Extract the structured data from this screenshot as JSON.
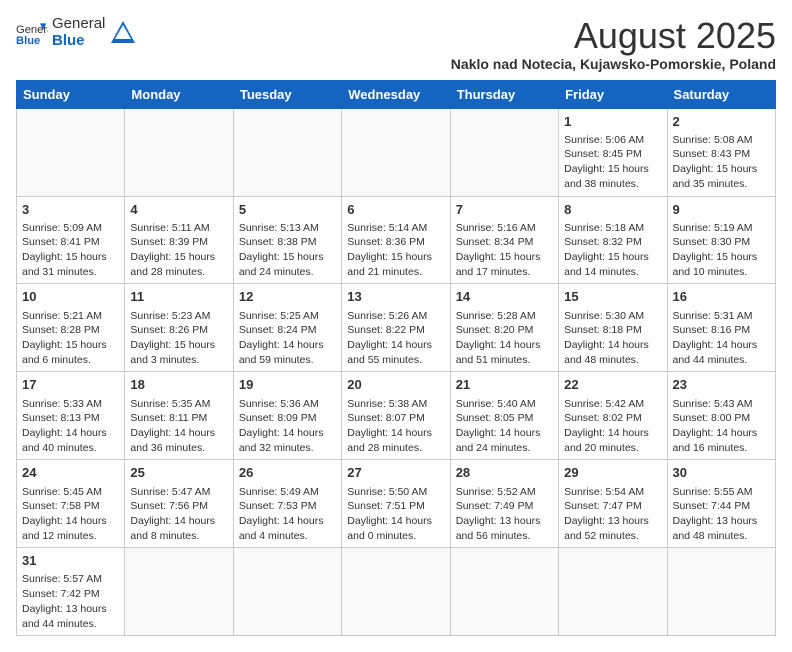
{
  "header": {
    "logo_general": "General",
    "logo_blue": "Blue",
    "month_title": "August 2025",
    "location": "Naklo nad Notecia, Kujawsko-Pomorskie, Poland"
  },
  "days_of_week": [
    "Sunday",
    "Monday",
    "Tuesday",
    "Wednesday",
    "Thursday",
    "Friday",
    "Saturday"
  ],
  "weeks": [
    [
      {
        "day": "",
        "info": ""
      },
      {
        "day": "",
        "info": ""
      },
      {
        "day": "",
        "info": ""
      },
      {
        "day": "",
        "info": ""
      },
      {
        "day": "",
        "info": ""
      },
      {
        "day": "1",
        "info": "Sunrise: 5:06 AM\nSunset: 8:45 PM\nDaylight: 15 hours and 38 minutes."
      },
      {
        "day": "2",
        "info": "Sunrise: 5:08 AM\nSunset: 8:43 PM\nDaylight: 15 hours and 35 minutes."
      }
    ],
    [
      {
        "day": "3",
        "info": "Sunrise: 5:09 AM\nSunset: 8:41 PM\nDaylight: 15 hours and 31 minutes."
      },
      {
        "day": "4",
        "info": "Sunrise: 5:11 AM\nSunset: 8:39 PM\nDaylight: 15 hours and 28 minutes."
      },
      {
        "day": "5",
        "info": "Sunrise: 5:13 AM\nSunset: 8:38 PM\nDaylight: 15 hours and 24 minutes."
      },
      {
        "day": "6",
        "info": "Sunrise: 5:14 AM\nSunset: 8:36 PM\nDaylight: 15 hours and 21 minutes."
      },
      {
        "day": "7",
        "info": "Sunrise: 5:16 AM\nSunset: 8:34 PM\nDaylight: 15 hours and 17 minutes."
      },
      {
        "day": "8",
        "info": "Sunrise: 5:18 AM\nSunset: 8:32 PM\nDaylight: 15 hours and 14 minutes."
      },
      {
        "day": "9",
        "info": "Sunrise: 5:19 AM\nSunset: 8:30 PM\nDaylight: 15 hours and 10 minutes."
      }
    ],
    [
      {
        "day": "10",
        "info": "Sunrise: 5:21 AM\nSunset: 8:28 PM\nDaylight: 15 hours and 6 minutes."
      },
      {
        "day": "11",
        "info": "Sunrise: 5:23 AM\nSunset: 8:26 PM\nDaylight: 15 hours and 3 minutes."
      },
      {
        "day": "12",
        "info": "Sunrise: 5:25 AM\nSunset: 8:24 PM\nDaylight: 14 hours and 59 minutes."
      },
      {
        "day": "13",
        "info": "Sunrise: 5:26 AM\nSunset: 8:22 PM\nDaylight: 14 hours and 55 minutes."
      },
      {
        "day": "14",
        "info": "Sunrise: 5:28 AM\nSunset: 8:20 PM\nDaylight: 14 hours and 51 minutes."
      },
      {
        "day": "15",
        "info": "Sunrise: 5:30 AM\nSunset: 8:18 PM\nDaylight: 14 hours and 48 minutes."
      },
      {
        "day": "16",
        "info": "Sunrise: 5:31 AM\nSunset: 8:16 PM\nDaylight: 14 hours and 44 minutes."
      }
    ],
    [
      {
        "day": "17",
        "info": "Sunrise: 5:33 AM\nSunset: 8:13 PM\nDaylight: 14 hours and 40 minutes."
      },
      {
        "day": "18",
        "info": "Sunrise: 5:35 AM\nSunset: 8:11 PM\nDaylight: 14 hours and 36 minutes."
      },
      {
        "day": "19",
        "info": "Sunrise: 5:36 AM\nSunset: 8:09 PM\nDaylight: 14 hours and 32 minutes."
      },
      {
        "day": "20",
        "info": "Sunrise: 5:38 AM\nSunset: 8:07 PM\nDaylight: 14 hours and 28 minutes."
      },
      {
        "day": "21",
        "info": "Sunrise: 5:40 AM\nSunset: 8:05 PM\nDaylight: 14 hours and 24 minutes."
      },
      {
        "day": "22",
        "info": "Sunrise: 5:42 AM\nSunset: 8:02 PM\nDaylight: 14 hours and 20 minutes."
      },
      {
        "day": "23",
        "info": "Sunrise: 5:43 AM\nSunset: 8:00 PM\nDaylight: 14 hours and 16 minutes."
      }
    ],
    [
      {
        "day": "24",
        "info": "Sunrise: 5:45 AM\nSunset: 7:58 PM\nDaylight: 14 hours and 12 minutes."
      },
      {
        "day": "25",
        "info": "Sunrise: 5:47 AM\nSunset: 7:56 PM\nDaylight: 14 hours and 8 minutes."
      },
      {
        "day": "26",
        "info": "Sunrise: 5:49 AM\nSunset: 7:53 PM\nDaylight: 14 hours and 4 minutes."
      },
      {
        "day": "27",
        "info": "Sunrise: 5:50 AM\nSunset: 7:51 PM\nDaylight: 14 hours and 0 minutes."
      },
      {
        "day": "28",
        "info": "Sunrise: 5:52 AM\nSunset: 7:49 PM\nDaylight: 13 hours and 56 minutes."
      },
      {
        "day": "29",
        "info": "Sunrise: 5:54 AM\nSunset: 7:47 PM\nDaylight: 13 hours and 52 minutes."
      },
      {
        "day": "30",
        "info": "Sunrise: 5:55 AM\nSunset: 7:44 PM\nDaylight: 13 hours and 48 minutes."
      }
    ],
    [
      {
        "day": "31",
        "info": "Sunrise: 5:57 AM\nSunset: 7:42 PM\nDaylight: 13 hours and 44 minutes."
      },
      {
        "day": "",
        "info": ""
      },
      {
        "day": "",
        "info": ""
      },
      {
        "day": "",
        "info": ""
      },
      {
        "day": "",
        "info": ""
      },
      {
        "day": "",
        "info": ""
      },
      {
        "day": "",
        "info": ""
      }
    ]
  ]
}
